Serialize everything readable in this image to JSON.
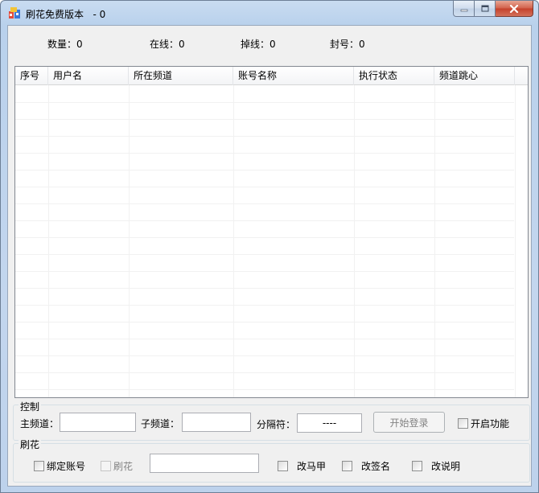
{
  "window": {
    "title": "刷花免费版本   - 0"
  },
  "stats": {
    "count_label": "数量：0",
    "online_label": "在线：0",
    "offline_label": "掉线：0",
    "banned_label": "封号：0"
  },
  "table": {
    "columns": [
      "序号",
      "用户名",
      "所在频道",
      "账号名称",
      "执行状态",
      "频道跳心"
    ],
    "rows": []
  },
  "control": {
    "group_label": "控制",
    "main_channel_label": "主频道：",
    "main_channel_value": "",
    "sub_channel_label": "子频道：",
    "sub_channel_value": "",
    "separator_label": "分隔符：",
    "separator_value": "----",
    "start_login_button": "开始登录",
    "enable_function_label": "开启功能"
  },
  "brush": {
    "group_label": "刷花",
    "bind_account_label": "绑定账号",
    "brush_flower_label": "刷花",
    "brush_text_value": "",
    "change_vest_label": "改马甲",
    "change_signature_label": "改签名",
    "change_description_label": "改说明"
  },
  "colors": {
    "title_gradient_top": "#c9dcf1",
    "close_button": "#c4402a",
    "client_bg": "#f0f0f0",
    "grid_border": "#828790"
  }
}
